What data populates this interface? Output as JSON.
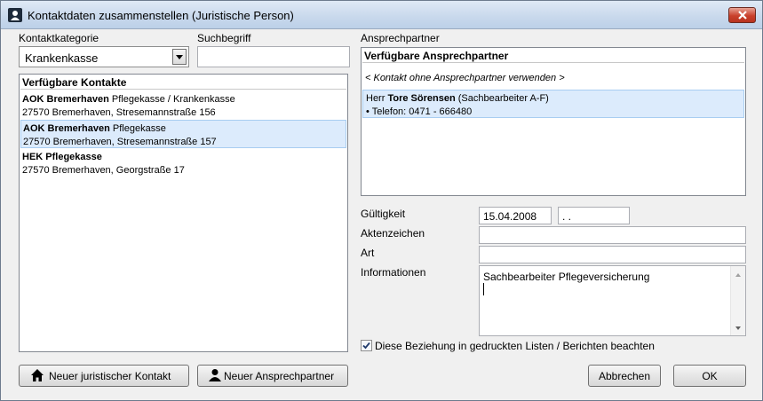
{
  "window": {
    "title": "Kontaktdaten zusammenstellen (Juristische Person)"
  },
  "left": {
    "category_label": "Kontaktkategorie",
    "category_value": "Krankenkasse",
    "search_label": "Suchbegriff",
    "search_value": "",
    "list_header": "Verfügbare Kontakte",
    "contacts": [
      {
        "name": "AOK Bremerhaven",
        "type": "Pflegekasse / Krankenkasse",
        "address": "27570 Bremerhaven, Stresemannstraße 156",
        "selected": false
      },
      {
        "name": "AOK Bremerhaven",
        "type": "Pflegekasse",
        "address": "27570 Bremerhaven, Stresemannstraße 157",
        "selected": true
      },
      {
        "name": "HEK Pflegekasse",
        "type": "",
        "address": "27570 Bremerhaven, Georgstraße 17",
        "selected": false
      }
    ]
  },
  "right": {
    "partner_label": "Ansprechpartner",
    "partner_header": "Verfügbare Ansprechpartner",
    "partner_none": "< Kontakt ohne Ansprechpartner verwenden >",
    "partner": {
      "salutation": "Herr",
      "name": "Tore Sörensen",
      "role": "(Sachbearbeiter A-F)",
      "phone": "• Telefon: 0471 - 666480"
    },
    "validity_label": "Gültigkeit",
    "validity_from": "15.04.2008",
    "validity_to": " . .",
    "file_ref_label": "Aktenzeichen",
    "file_ref_value": "",
    "type_label": "Art",
    "type_value": "",
    "info_label": "Informationen",
    "info_value": "Sachbearbeiter Pflegeversicherung",
    "print_checkbox_label": "Diese Beziehung in gedruckten Listen / Berichten beachten",
    "print_checkbox_checked": true
  },
  "buttons": {
    "new_legal_contact": "Neuer juristischer Kontakt",
    "new_partner": "Neuer Ansprechpartner",
    "cancel": "Abbrechen",
    "ok": "OK"
  },
  "icons": {
    "title": "person-card-icon",
    "close": "close-icon",
    "house": "house-icon",
    "person": "person-icon",
    "dropdown": "chevron-down-icon",
    "check": "checkmark-icon"
  }
}
